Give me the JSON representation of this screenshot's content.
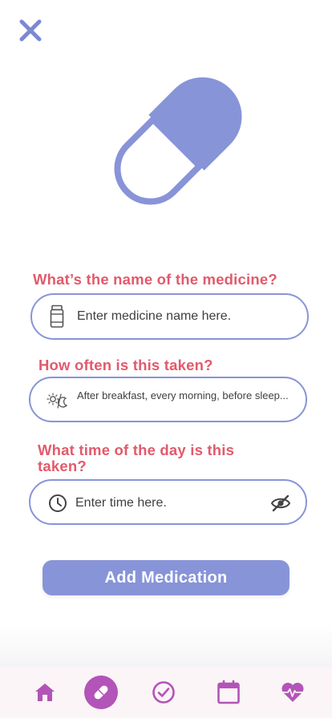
{
  "header": {
    "close_icon": "close-icon"
  },
  "illustration": {
    "icon": "pill-capsule-icon",
    "color": "#8894d8"
  },
  "form": {
    "medicine_name": {
      "question": "What’s the name of the medicine?",
      "placeholder": "Enter medicine name here.",
      "icon": "medicine-bottle-icon"
    },
    "frequency": {
      "question": "How often is this taken?",
      "placeholder": "After breakfast, every morning, before sleep...",
      "icon": "day-night-icon"
    },
    "time": {
      "question": "What time of the day is this taken?",
      "placeholder": "Enter time here.",
      "icon": "clock-icon",
      "trailing_icon": "eye-off-icon"
    },
    "submit_label": "Add Medication"
  },
  "tab_bar": {
    "items": [
      {
        "name": "home",
        "icon": "home-icon",
        "active": false
      },
      {
        "name": "medication",
        "icon": "pill-icon",
        "active": true
      },
      {
        "name": "tasks",
        "icon": "check-circle-icon",
        "active": false
      },
      {
        "name": "calendar",
        "icon": "calendar-icon",
        "active": false
      },
      {
        "name": "health",
        "icon": "heartbeat-icon",
        "active": false
      }
    ]
  },
  "colors": {
    "accent": "#8894d8",
    "question_text": "#e25a6b",
    "tab_icon": "#b354b8",
    "tab_bar_bg": "#fbf5f7"
  }
}
